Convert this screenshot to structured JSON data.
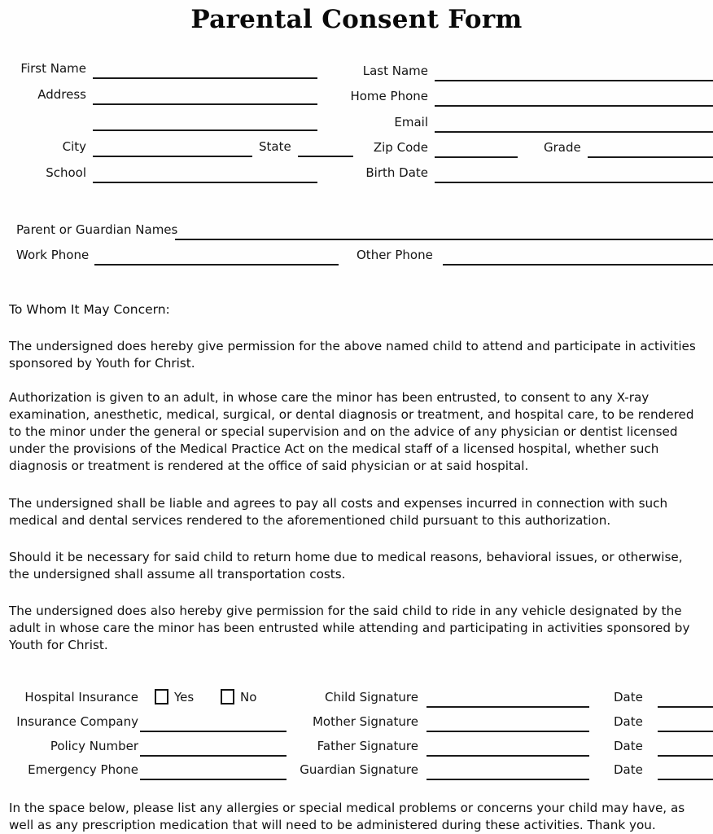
{
  "document": {
    "title": "Parental Consent Form"
  },
  "identity_fields": {
    "left": [
      {
        "label": "First Name"
      },
      {
        "label": "Address"
      },
      {
        "label": ""
      },
      {
        "label": "City"
      },
      {
        "label": "School"
      }
    ],
    "right": [
      {
        "label": "Last Name"
      },
      {
        "label": "Home Phone"
      },
      {
        "label": "Email"
      },
      {
        "label": "Zip Code"
      },
      {
        "label": "Birth Date"
      }
    ],
    "inline": [
      {
        "label": "State"
      },
      {
        "label": "Grade"
      }
    ]
  },
  "guardian_fields": {
    "names_label": "Parent or Guardian Names",
    "work_phone_label": "Work Phone",
    "other_phone_label": "Other Phone"
  },
  "letter": {
    "salutation": "To Whom It May Concern:",
    "paragraphs": [
      "The undersigned does hereby give permission for the above named child to attend and participate in activities sponsored by Youth for Christ.",
      "Authorization is given to an adult, in whose care the minor has been entrusted, to consent to any X-ray examination, anesthetic, medical, surgical, or dental diagnosis or treatment, and hospital care, to be rendered to the minor under the general or special supervision and on the advice of any physician or dentist licensed under the provisions of the Medical Practice Act on the medical staff of a licensed hospital, whether such diagnosis or treatment is rendered at the office of said physician or at said hospital.",
      "The undersigned shall be liable and agrees to pay all costs and expenses incurred in connection with such medical and dental services rendered to the aforementioned child pursuant to this authorization.",
      "Should it be necessary for said child to return home due to medical reasons, behavioral issues, or otherwise, the undersigned shall assume all transportation costs.",
      "The undersigned does also hereby give permission for the said child to ride in any vehicle designated by the adult in whose care the minor has been entrusted while attending and participating in activities sponsored by Youth for Christ."
    ]
  },
  "insurance": {
    "hospital_insurance_label": "Hospital Insurance",
    "yes_label": "Yes",
    "no_label": "No",
    "company_label": "Insurance Company",
    "policy_label": "Policy Number",
    "emergency_label": "Emergency Phone"
  },
  "signatures": {
    "rows": [
      {
        "label": "Child Signature",
        "date_label": "Date"
      },
      {
        "label": "Mother Signature",
        "date_label": "Date"
      },
      {
        "label": "Father Signature",
        "date_label": "Date"
      },
      {
        "label": "Guardian Signature",
        "date_label": "Date"
      }
    ]
  },
  "footer": {
    "text": "In the space below, please list any allergies or special medical problems or concerns your child may have, as well as any prescription medication that will need to be administered during these activities.  Thank you."
  },
  "colors": {
    "ink": "#111111",
    "rule": "#1a1a1a",
    "page": "#ffffff"
  }
}
